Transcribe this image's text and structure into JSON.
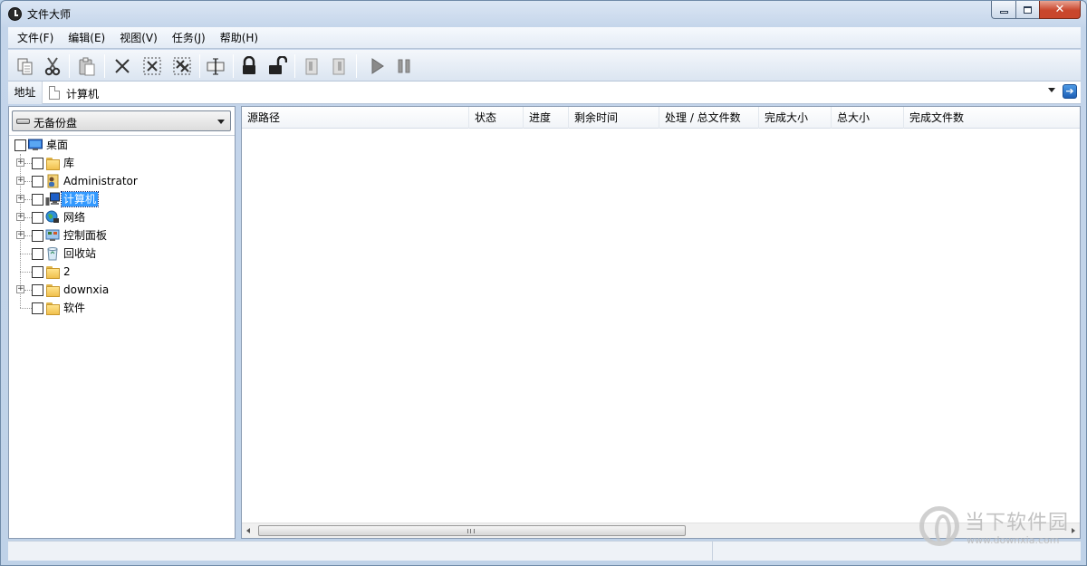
{
  "window": {
    "title": "文件大师"
  },
  "menu": [
    "文件(F)",
    "编辑(E)",
    "视图(V)",
    "任务(J)",
    "帮助(H)"
  ],
  "address": {
    "label": "地址",
    "value": "计算机"
  },
  "backup_select": {
    "value": "无备份盘"
  },
  "tree": [
    {
      "label": "桌面",
      "icon": "desktop-icon",
      "expandable": false,
      "root": true
    },
    {
      "label": "库",
      "icon": "library-icon",
      "expandable": true
    },
    {
      "label": "Administrator",
      "icon": "user-folder-icon",
      "expandable": true
    },
    {
      "label": "计算机",
      "icon": "computer-icon",
      "expandable": true,
      "selected": true
    },
    {
      "label": "网络",
      "icon": "network-icon",
      "expandable": true
    },
    {
      "label": "控制面板",
      "icon": "control-panel-icon",
      "expandable": true
    },
    {
      "label": "回收站",
      "icon": "recycle-bin-icon",
      "expandable": false
    },
    {
      "label": "2",
      "icon": "folder-icon",
      "expandable": false
    },
    {
      "label": "downxia",
      "icon": "folder-icon",
      "expandable": true
    },
    {
      "label": "软件",
      "icon": "folder-icon",
      "expandable": false
    }
  ],
  "columns": [
    "源路径",
    "状态",
    "进度",
    "剩余时间",
    "处理 / 总文件数",
    "完成大小",
    "总大小",
    "完成文件数"
  ],
  "watermark": {
    "text": "当下软件园",
    "url": "www.downxia.com"
  }
}
